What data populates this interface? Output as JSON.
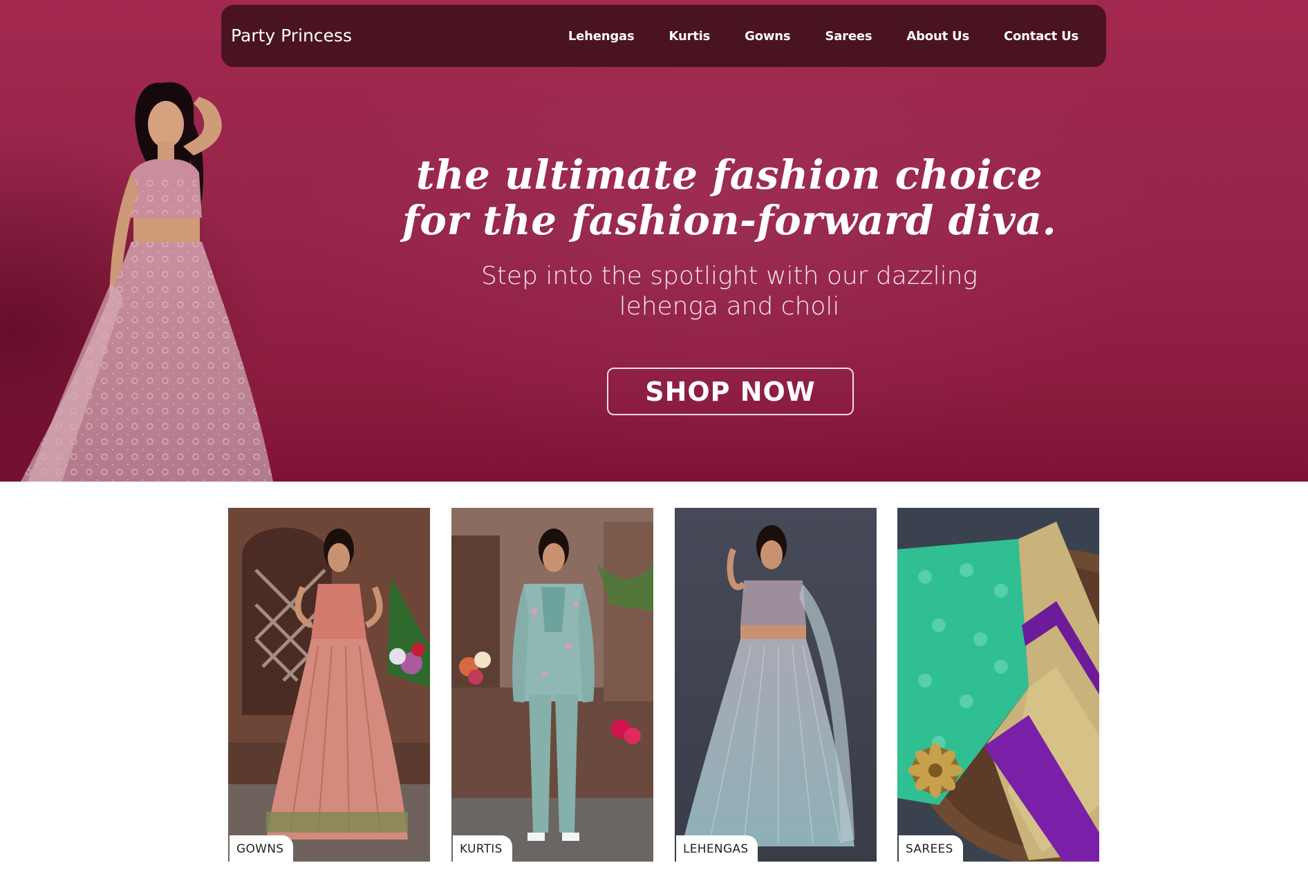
{
  "header": {
    "brand": "Party Princess",
    "nav": [
      {
        "label": "Lehengas"
      },
      {
        "label": "Kurtis"
      },
      {
        "label": "Gowns"
      },
      {
        "label": "Sarees"
      },
      {
        "label": "About Us"
      },
      {
        "label": "Contact Us"
      }
    ]
  },
  "hero": {
    "tagline_line1": "the ultimate fashion choice",
    "tagline_line2": "for the fashion-forward diva.",
    "sub_line1": "Step into the spotlight with our dazzling",
    "sub_line2": "lehenga and choli",
    "cta": "SHOP NOW"
  },
  "categories": [
    {
      "label": "GOWNS"
    },
    {
      "label": "KURTIS"
    },
    {
      "label": "LEHENGAS"
    },
    {
      "label": "SAREES"
    }
  ],
  "colors": {
    "hero_background": "#952549",
    "navbar_background": "#4a1322",
    "text_on_hero": "#ffffff"
  }
}
